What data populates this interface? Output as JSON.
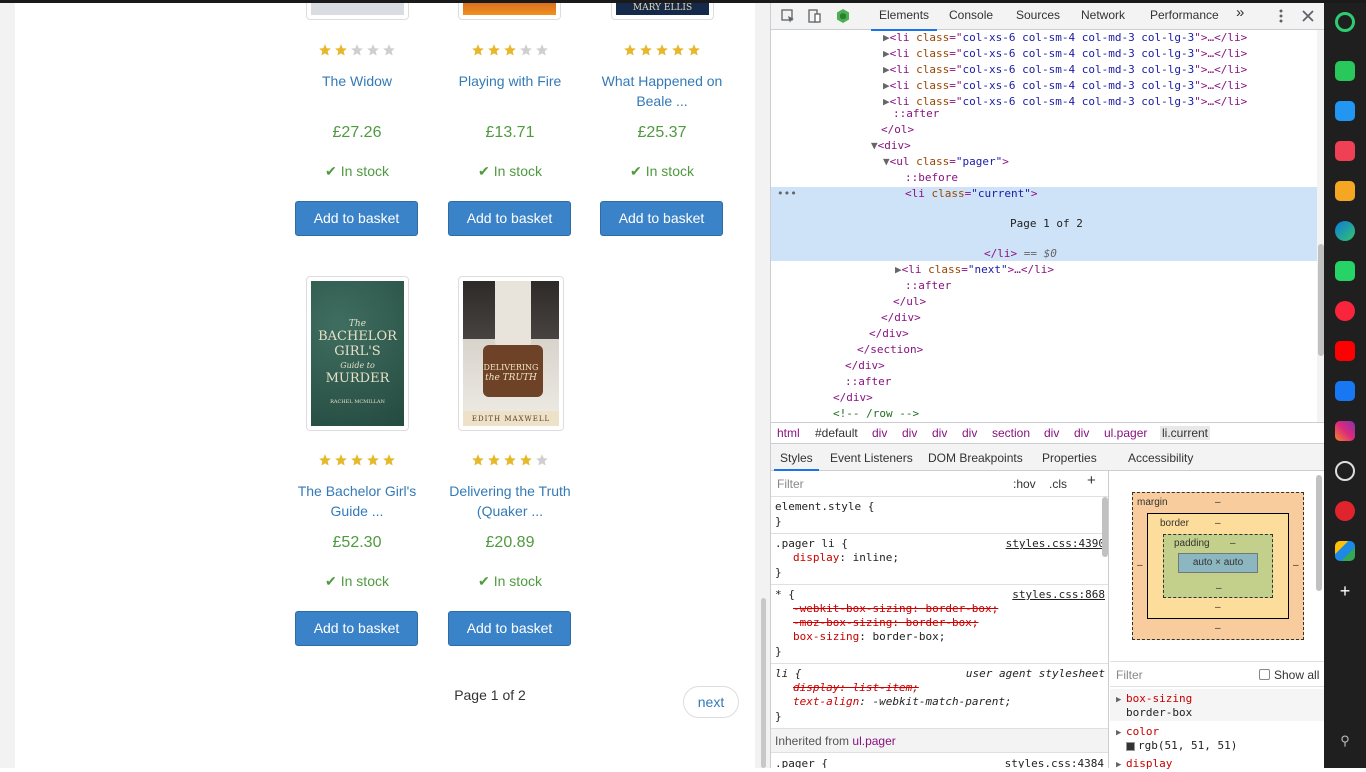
{
  "products_row1": [
    {
      "title_lines": [
        "The Widow"
      ],
      "price": "£27.26",
      "stock": "In stock",
      "rating": 2,
      "button": "Add to basket"
    },
    {
      "title_lines": [
        "Playing with Fire"
      ],
      "price": "£13.71",
      "stock": "In stock",
      "rating": 3,
      "button": "Add to basket"
    },
    {
      "title_lines": [
        "What Happened on",
        "Beale ..."
      ],
      "price": "£25.37",
      "stock": "In stock",
      "rating": 5,
      "button": "Add to basket"
    }
  ],
  "products_row2": [
    {
      "title_lines": [
        "The Bachelor Girl's",
        "Guide ..."
      ],
      "price": "£52.30",
      "stock": "In stock",
      "rating": 5,
      "button": "Add to basket",
      "cover_text": [
        "The",
        "BACHELOR",
        "GIRL'S",
        "Guide to",
        "MURDER",
        "RACHEL MCMILLAN"
      ]
    },
    {
      "title_lines": [
        "Delivering the Truth",
        "(Quaker ..."
      ],
      "price": "£20.89",
      "stock": "In stock",
      "rating": 4,
      "button": "Add to basket",
      "cover_text": [
        "DELIVERING",
        "the TRUTH",
        "EDITH MAXWELL"
      ]
    }
  ],
  "row1_cover_partial_text": "MARY ELLIS",
  "pager": {
    "current": "Page 1 of 2",
    "next": "next"
  },
  "devtools": {
    "tabs": [
      "Elements",
      "Console",
      "Sources",
      "Network",
      "Performance"
    ],
    "active_tab": "Elements",
    "more_tabs": "»",
    "dom_lines": [
      {
        "indent": 0,
        "arrow": "▶",
        "html": "li",
        "attr": "col-xs-6 col-sm-4 col-md-3 col-lg-3",
        "tail": ">…</li>"
      },
      {
        "indent": 0,
        "arrow": "▶",
        "html": "li",
        "attr": "col-xs-6 col-sm-4 col-md-3 col-lg-3",
        "tail": ">…</li>"
      },
      {
        "indent": 0,
        "arrow": "▶",
        "html": "li",
        "attr": "col-xs-6 col-sm-4 col-md-3 col-lg-3",
        "tail": ">…</li>"
      },
      {
        "indent": 0,
        "arrow": "▶",
        "html": "li",
        "attr": "col-xs-6 col-sm-4 col-md-3 col-lg-3",
        "tail": ">…</li>"
      },
      {
        "indent": 0,
        "arrow": "▶",
        "html": "li",
        "attr": "col-xs-6 col-sm-4 col-md-3 col-lg-3",
        "tail": ">…</li>"
      }
    ],
    "dom_text": {
      "after1": "::after",
      "ol_close": "</ol>",
      "div_open": "<div>",
      "ul_open_tag": "<ul ",
      "ul_attr_name": "class",
      "ul_attr_val": "\"pager\"",
      "before": "::before",
      "li_current_tag": "<li ",
      "li_current_attr": "class",
      "li_current_val": "\"current\"",
      "li_current_text": "Page 1 of 2",
      "li_close": "</li>",
      "eq": " == $0",
      "li_next_tag": "<li ",
      "li_next_attr": "class",
      "li_next_val": "\"next\"",
      "li_next_tail": ">…</li>",
      "after2": "::after",
      "ul_close": "</ul>",
      "div_close1": "</div>",
      "div_close2": "</div>",
      "section_close": "</section>",
      "div_close3": "</div>",
      "after3": "::after",
      "div_close4": "</div>",
      "comment": "<!-- /row -->",
      "ellipsis": "•••"
    },
    "breadcrumbs": [
      "html",
      "#default",
      "div",
      "div",
      "div",
      "div",
      "section",
      "div",
      "div",
      "ul.pager",
      "li.current"
    ],
    "subtabs": [
      "Styles",
      "Event Listeners",
      "DOM Breakpoints",
      "Properties",
      "Accessibility"
    ],
    "filter_placeholder": "Filter",
    "hov": ":hov",
    "cls": ".cls",
    "plus": "+",
    "styles": {
      "element_style": "element.style {",
      "close": "}",
      "r1_sel": ".pager li {",
      "r1_src": "styles.css:4390",
      "r1_prop": "display",
      "r1_val": "inline;",
      "r2_sel": "* {",
      "r2_src": "styles.css:868",
      "r2_p1": "-webkit-box-sizing: border-box;",
      "r2_p2": "-moz-box-sizing: border-box;",
      "r2_p3": "box-sizing",
      "r2_v3": "border-box;",
      "r3_sel": "li {",
      "r3_src": "user agent stylesheet",
      "r3_p1": "display: list-item;",
      "r3_p2": "text-align",
      "r3_v2": "-webkit-match-parent;",
      "inherited_label": "Inherited from",
      "inherited_from": "ul.pager",
      "r4_sel": ".pager {",
      "r4_src": "styles.css:4384"
    },
    "boxmodel": {
      "margin": "margin",
      "border": "border",
      "padding": "padding",
      "content": "auto × auto",
      "dash": "–"
    },
    "computed": {
      "filter": "Filter",
      "show_all": "Show all",
      "p1": "box-sizing",
      "v1": "border-box",
      "p2": "color",
      "v2": "rgb(51, 51, 51)",
      "p3": "display"
    }
  },
  "colors": {
    "link": "#337ab7",
    "price": "#4f9a3f",
    "button": "#3a83c8",
    "star": "#e6b82c",
    "star_off": "#cfcfcf",
    "selected_row": "#cfe3f8"
  }
}
